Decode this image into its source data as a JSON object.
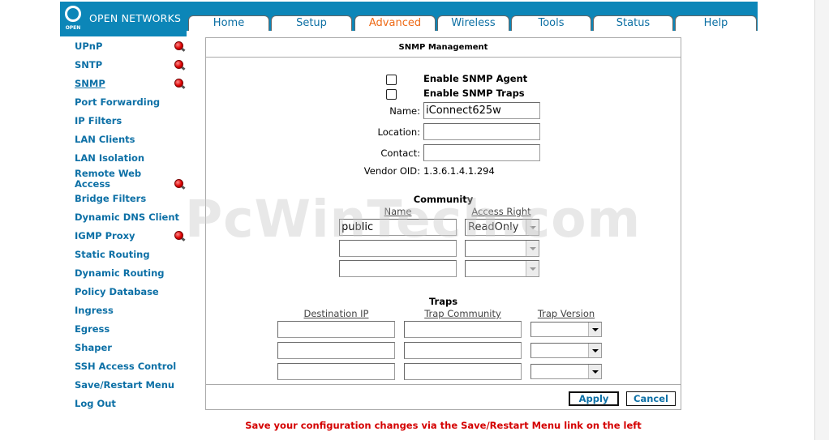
{
  "brand": {
    "logo_word": "OPEN",
    "name": "OPEN NETWORKS"
  },
  "tabs": [
    {
      "label": "Home",
      "active": false
    },
    {
      "label": "Setup",
      "active": false
    },
    {
      "label": "Advanced",
      "active": true
    },
    {
      "label": "Wireless",
      "active": false
    },
    {
      "label": "Tools",
      "active": false
    },
    {
      "label": "Status",
      "active": false
    },
    {
      "label": "Help",
      "active": false
    }
  ],
  "menu": [
    {
      "label": "UPnP",
      "dot": true
    },
    {
      "label": "SNTP",
      "dot": true
    },
    {
      "label": "SNMP",
      "dot": true,
      "current": true
    },
    {
      "label": "Port Forwarding",
      "dot": false
    },
    {
      "label": "IP Filters",
      "dot": false
    },
    {
      "label": "LAN Clients",
      "dot": false
    },
    {
      "label": "LAN Isolation",
      "dot": false
    },
    {
      "label": "Remote Web Access",
      "dot": true
    },
    {
      "label": "Bridge Filters",
      "dot": false
    },
    {
      "label": "Dynamic DNS Client",
      "dot": false
    },
    {
      "label": "IGMP Proxy",
      "dot": true
    },
    {
      "label": "Static Routing",
      "dot": false
    },
    {
      "label": "Dynamic Routing",
      "dot": false
    },
    {
      "label": "Policy Database",
      "dot": false
    },
    {
      "label": "Ingress",
      "dot": false
    },
    {
      "label": "Egress",
      "dot": false
    },
    {
      "label": "Shaper",
      "dot": false
    },
    {
      "label": "SSH Access Control",
      "dot": false
    },
    {
      "label": "Save/Restart Menu",
      "dot": false
    },
    {
      "label": "Log Out",
      "dot": false
    }
  ],
  "panel": {
    "title": "SNMP Management",
    "enable_agent": {
      "label": "Enable SNMP Agent",
      "checked": false
    },
    "enable_traps": {
      "label": "Enable SNMP Traps",
      "checked": false
    },
    "name": {
      "label": "Name:",
      "value": "iConnect625w"
    },
    "location": {
      "label": "Location:",
      "value": ""
    },
    "contact": {
      "label": "Contact:",
      "value": ""
    },
    "vendor_oid": {
      "label": "Vendor OID:",
      "value": "1.3.6.1.4.1.294"
    },
    "community": {
      "title": "Community",
      "col_name": "Name",
      "col_access": "Access Right",
      "rows": [
        {
          "name": "public",
          "access": "ReadOnly"
        },
        {
          "name": "",
          "access": ""
        },
        {
          "name": "",
          "access": ""
        }
      ]
    },
    "traps": {
      "title": "Traps",
      "col_dest": "Destination IP",
      "col_community": "Trap Community",
      "col_version": "Trap Version",
      "rows": [
        {
          "dest": "",
          "community": "",
          "version": ""
        },
        {
          "dest": "",
          "community": "",
          "version": ""
        },
        {
          "dest": "",
          "community": "",
          "version": ""
        }
      ]
    },
    "apply_label": "Apply",
    "cancel_label": "Cancel"
  },
  "watermark": "PcWinTech.com",
  "footer_message": "Save your configuration changes via the Save/Restart Menu link on the left",
  "colors": {
    "brand_blue": "#0c86b8",
    "link_blue": "#0d70a6",
    "active_tab": "#ee6a16",
    "warning_red": "#d40000"
  }
}
